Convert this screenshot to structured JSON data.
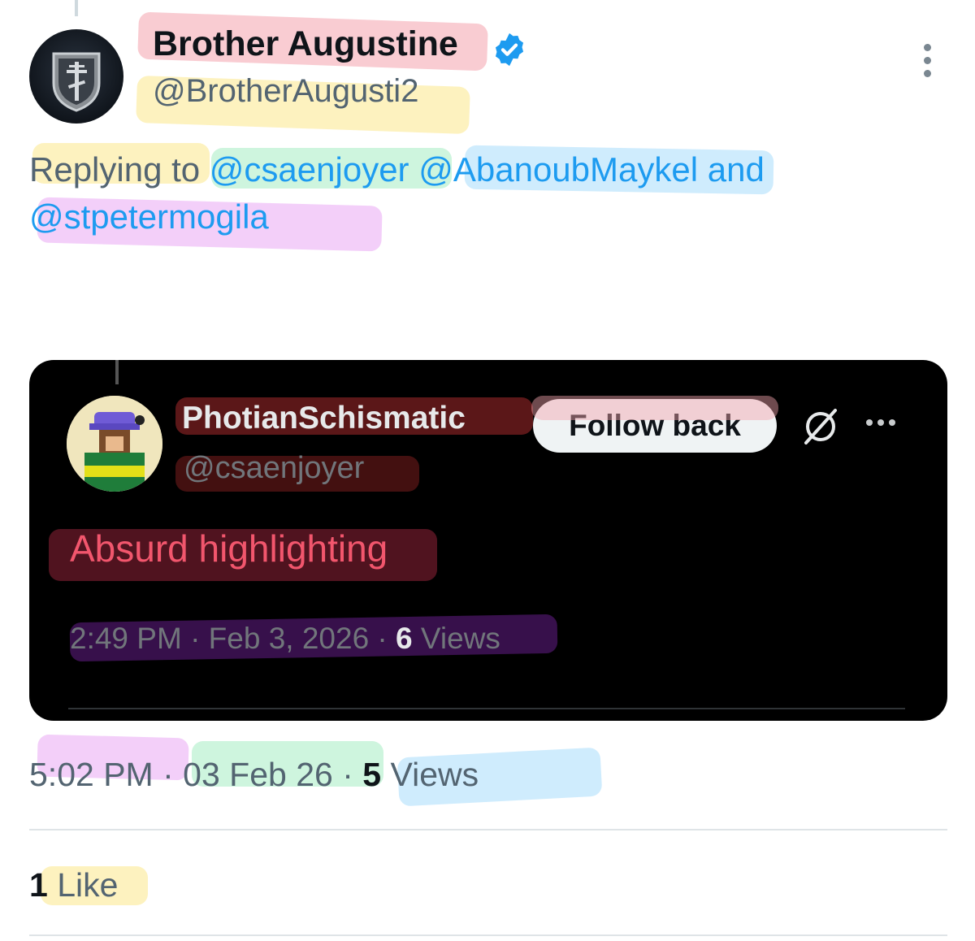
{
  "tweet": {
    "author_name": "Brother Augustine",
    "author_handle": "@BrotherAugusti2",
    "replying_prefix": "Replying to ",
    "mentions": [
      "@csaenjoyer",
      "@AbanoubMaykel",
      "@stpetermogila"
    ],
    "and_word": " and",
    "time": "5:02 PM",
    "date": "03 Feb 26",
    "separator": "·",
    "view_count": "5",
    "views_label": "Views",
    "like_count": "1",
    "like_label": "Like"
  },
  "quoted": {
    "author_name": "PhotianSchismatic",
    "author_handle": "@csaenjoyer",
    "follow_label": "Follow back",
    "text": "Absurd highlighting",
    "time_date": "2:49 PM · Feb 3, 2026 · ",
    "view_count": "6",
    "views_label": "Views"
  },
  "icons": {
    "verified": "verified-badge-icon",
    "more": "more-vertical-icon",
    "grok": "grok-icon",
    "more_horizontal": "more-horizontal-icon"
  },
  "colors": {
    "accent": "#1d9bf0",
    "secondary_text": "#536471",
    "quoted_text": "#f2566d",
    "highlight_red": "#f4a3ad",
    "highlight_yellow": "#fbe78a",
    "highlight_green": "#a6ecc3",
    "highlight_blue": "#a7dcfb",
    "highlight_pink": "#eaa8f4"
  }
}
